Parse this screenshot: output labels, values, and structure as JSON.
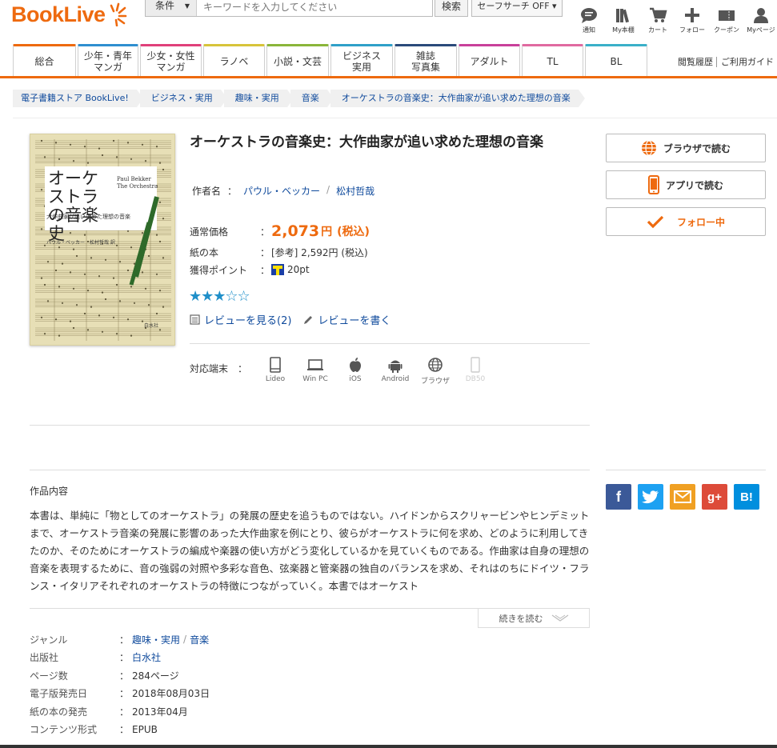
{
  "header": {
    "logo": "BookLive",
    "search": {
      "condition": "条件",
      "placeholder": "キーワードを入力してください",
      "button": "検索"
    },
    "safe_search": "セーフサーチ OFF ▾",
    "icons": [
      {
        "name": "notice-icon",
        "label": "通知"
      },
      {
        "name": "bookshelf-icon",
        "label": "My本棚"
      },
      {
        "name": "cart-icon",
        "label": "カート"
      },
      {
        "name": "follow-icon",
        "label": "フォロー"
      },
      {
        "name": "coupon-icon",
        "label": "クーポン"
      },
      {
        "name": "mypage-icon",
        "label": "Myページ"
      }
    ]
  },
  "tabs": [
    {
      "label": "総合",
      "color": "#ee6a0f",
      "width": 77
    },
    {
      "label": "少年・青年\nマンガ",
      "color": "#2f8fd0",
      "width": 77
    },
    {
      "label": "少女・女性\nマンガ",
      "color": "#e0407a",
      "width": 77
    },
    {
      "label": "ラノベ",
      "color": "#d7c43a",
      "width": 77
    },
    {
      "label": "小説・文芸",
      "color": "#8ab63a",
      "width": 77
    },
    {
      "label": "ビジネス\n実用",
      "color": "#2fa0c8",
      "width": 77
    },
    {
      "label": "雑誌\n写真集",
      "color": "#2a4a7a",
      "width": 77
    },
    {
      "label": "アダルト",
      "color": "#c8409a",
      "width": 77
    },
    {
      "label": "TL",
      "color": "#e06aa0",
      "width": 77
    },
    {
      "label": "BL",
      "color": "#3ab0c8",
      "width": 77
    }
  ],
  "subnav": {
    "history": "閲覧履歴",
    "guide": "ご利用ガイド"
  },
  "breadcrumbs": [
    "電子書籍ストア BookLive!",
    "ビジネス・実用",
    "趣味・実用",
    "音楽",
    "オーケストラの音楽史：大作曲家が追い求めた理想の音楽"
  ],
  "book": {
    "title": "オーケストラの音楽史：大作曲家が追い求めた理想の音楽",
    "author_label": "作者名",
    "author_colon": "：",
    "authors": [
      "パウル・ベッカー",
      "松村哲哉"
    ],
    "author_sep": "/",
    "price_label": "通常価格",
    "price": "2,073",
    "price_yen": "円",
    "price_tax": "(税込)",
    "paper_label": "紙の本",
    "paper_value": "[参考] 2,592円 (税込)",
    "points_label": "獲得ポイント",
    "points_value": "20pt",
    "rating": 3,
    "stars": "★★★☆☆",
    "review_view": "レビューを見る(2)",
    "review_write": "レビューを書く",
    "devices_label": "対応端末",
    "devices": [
      {
        "name": "lideo-device-icon",
        "label": "Lideo",
        "dim": false
      },
      {
        "name": "winpc-device-icon",
        "label": "Win PC",
        "dim": false
      },
      {
        "name": "ios-device-icon",
        "label": "iOS",
        "dim": false
      },
      {
        "name": "android-device-icon",
        "label": "Android",
        "dim": false
      },
      {
        "name": "browser-device-icon",
        "label": "ブラウザ",
        "dim": false
      },
      {
        "name": "db50-device-icon",
        "label": "DB50",
        "dim": true
      }
    ],
    "cover": {
      "title": "オーケストラの音楽史",
      "en": "Paul Bekker\nThe Orchestra",
      "sub": "大作曲家が追い求めた理想の音楽",
      "author": "パウル・ベッカー　松村哲哉 訳",
      "publisher": "白水社"
    }
  },
  "side": {
    "browser_read": "ブラウザで読む",
    "app_read": "アプリで読む",
    "following": "フォロー中"
  },
  "social": [
    "f",
    "t",
    "✉",
    "g+",
    "B!"
  ],
  "description": {
    "heading": "作品内容",
    "body": "本書は、単純に「物としてのオーケストラ」の発展の歴史を追うものではない。ハイドンからスクリャービンやヒンデミットまで、オーケストラ音楽の発展に影響のあった大作曲家を例にとり、彼らがオーケストラに何を求め、どのように利用してきたのか、そのためにオーケストラの編成や楽器の使い方がどう変化しているかを見ていくものである。作曲家は自身の理想の音楽を表現するために、音の強弱の対照や多彩な音色、弦楽器と管楽器の独自のバランスを求め、それはのちにドイツ・フランス・イタリアそれぞれのオーケストラの特徴につながっていく。本書ではオーケスト",
    "more": "続きを読む"
  },
  "info": [
    {
      "label": "ジャンル",
      "values": [
        "趣味・実用",
        "音楽"
      ],
      "link": true
    },
    {
      "label": "出版社",
      "values": [
        "白水社"
      ],
      "link": true
    },
    {
      "label": "ページ数",
      "values": [
        "284ページ"
      ],
      "link": false
    },
    {
      "label": "電子版発売日",
      "values": [
        "2018年08月03日"
      ],
      "link": false
    },
    {
      "label": "紙の本の発売",
      "values": [
        "2013年04月"
      ],
      "link": false
    },
    {
      "label": "コンテンツ形式",
      "values": [
        "EPUB"
      ],
      "link": false
    }
  ],
  "colors": {
    "accent": "#ee6a0f",
    "link": "#0f4a9c",
    "star": "#1f8fc9"
  }
}
